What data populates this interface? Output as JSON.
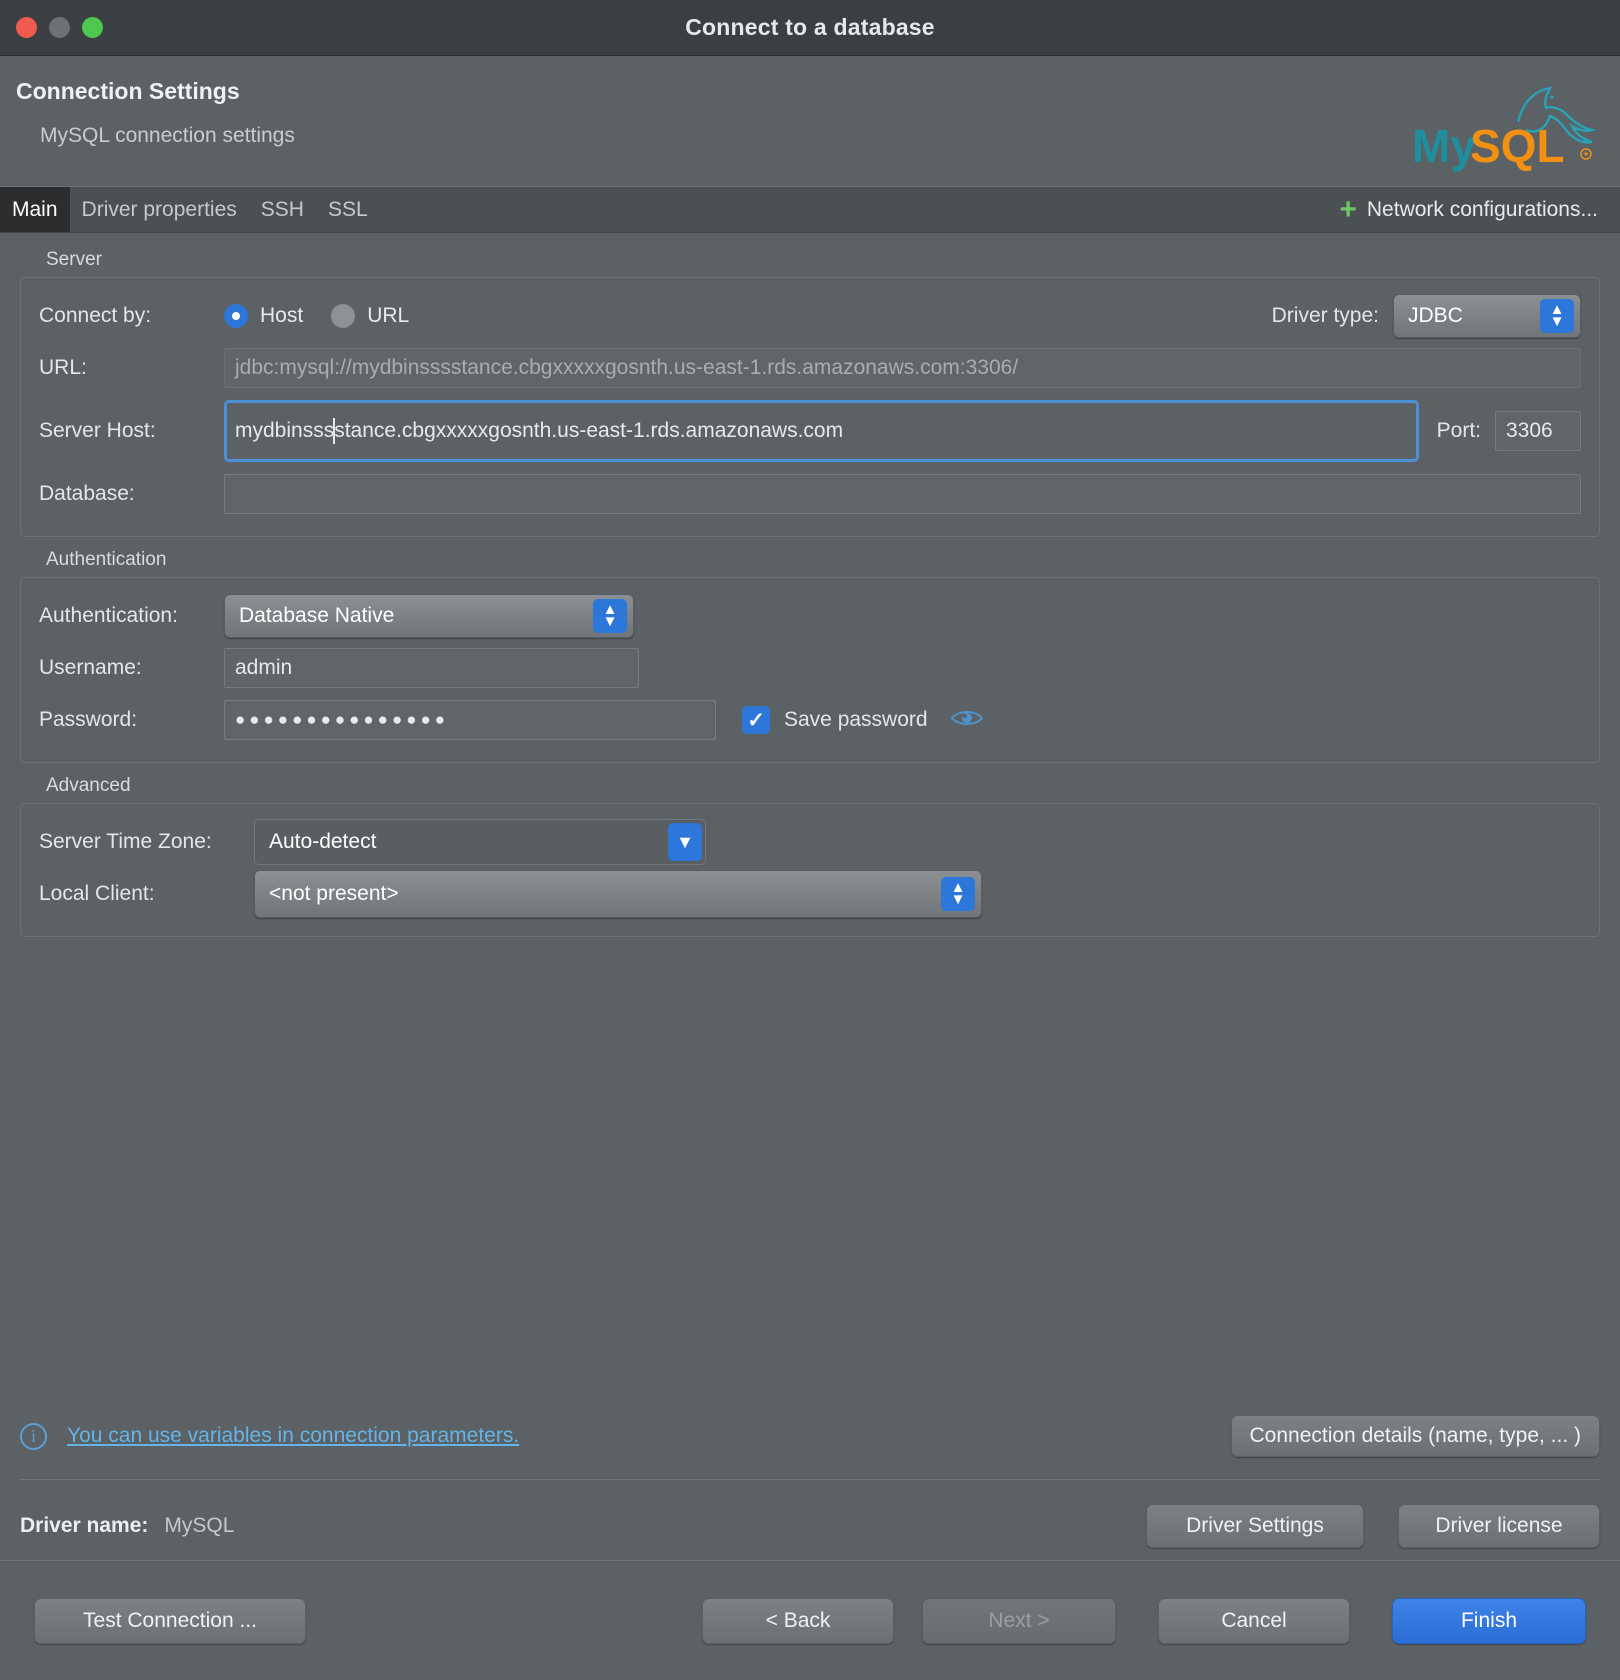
{
  "titlebar": {
    "title": "Connect to a database",
    "buttons": [
      "close-button",
      "minimize-button",
      "zoom-button"
    ]
  },
  "header": {
    "title": "Connection Settings",
    "subtitle": "MySQL connection settings",
    "logo_alt": "MySQL",
    "logo_my": "My",
    "logo_sql": "SQL"
  },
  "tabs": {
    "items": [
      {
        "label": "Main",
        "active": true
      },
      {
        "label": "Driver properties",
        "active": false
      },
      {
        "label": "SSH",
        "active": false
      },
      {
        "label": "SSL",
        "active": false
      }
    ],
    "network_configurations": "Network configurations...",
    "plus_glyph": "+"
  },
  "server": {
    "group_label": "Server",
    "connect_by_label": "Connect by:",
    "radio_host": "Host",
    "radio_url": "URL",
    "selected": "Host",
    "driver_type_label": "Driver type:",
    "driver_type_value": "JDBC",
    "url_label": "URL:",
    "url_value": "jdbc:mysql://mydbinsssstance.cbgxxxxxgosnth.us-east-1.rds.amazonaws.com:3306/",
    "server_host_label": "Server Host:",
    "server_host_before_caret": "mydbinsss",
    "server_host_after_caret": "stance.cbgxxxxxgosnth.us-east-1.rds.amazonaws.com",
    "port_label": "Port:",
    "port_value": "3306",
    "database_label": "Database:",
    "database_value": ""
  },
  "authentication": {
    "group_label": "Authentication",
    "auth_label": "Authentication:",
    "auth_value": "Database Native",
    "username_label": "Username:",
    "username_value": "admin",
    "password_label": "Password:",
    "password_value": "●●●●●●●●●●●●●●●",
    "save_password_label": "Save password",
    "save_password_checked": true,
    "check_glyph": "✓",
    "reveal_icon": "eye-icon"
  },
  "advanced": {
    "group_label": "Advanced",
    "time_zone_label": "Server Time Zone:",
    "time_zone_value": "Auto-detect",
    "local_client_label": "Local Client:",
    "local_client_value": "<not present>"
  },
  "info": {
    "link_text": "You can use variables in connection parameters.",
    "connection_details_button": "Connection details (name, type, ... )"
  },
  "driver": {
    "name_label": "Driver name:",
    "name_value": "MySQL",
    "settings_button": "Driver Settings",
    "license_button": "Driver license"
  },
  "footer": {
    "test_connection": "Test Connection ...",
    "back": "< Back",
    "next": "Next >",
    "cancel": "Cancel",
    "finish": "Finish",
    "next_disabled": true
  },
  "colors": {
    "accent_blue": "#2d76da",
    "link_blue": "#64b4e8",
    "focus_blue": "#4b90d4",
    "plus_green": "#6cc664",
    "mysql_teal": "#1e8f9e",
    "mysql_orange": "#f29111",
    "window_bg": "#5b6164",
    "titlebar_bg": "#3b3f41"
  }
}
